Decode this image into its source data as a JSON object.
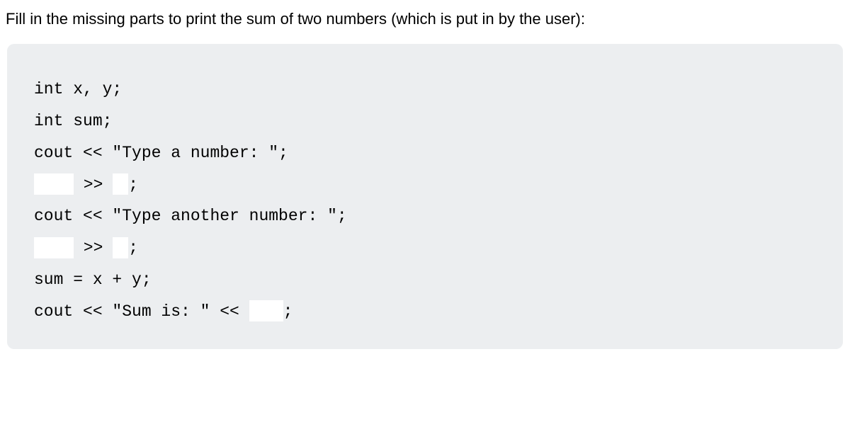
{
  "instruction": "Fill in the missing parts to print the sum of two numbers (which is put in by the user):",
  "code": {
    "l1": "int x, y;",
    "l2": "int sum;",
    "l3": "cout << \"Type a number: \";",
    "l4a": " >> ",
    "l4b": ";",
    "l5": "cout << \"Type another number: \";",
    "l6a": " >> ",
    "l6b": ";",
    "l7": "sum = x + y;",
    "l8a": "cout << \"Sum is: \" << ",
    "l8b": ";"
  }
}
